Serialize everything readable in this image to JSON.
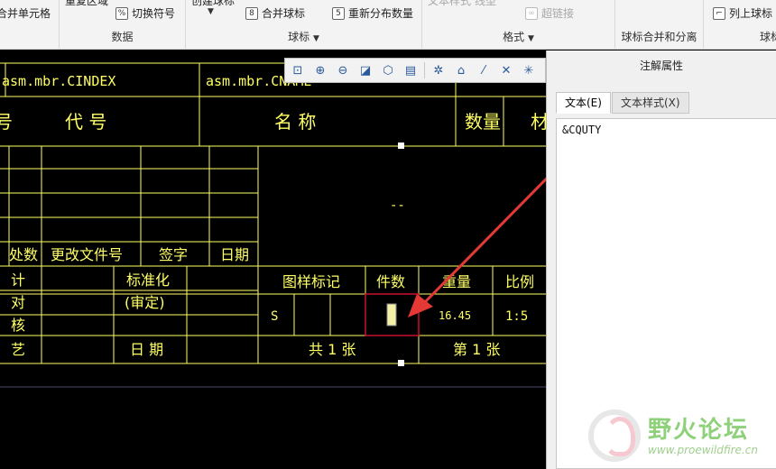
{
  "ribbon": {
    "row1": {
      "repeat_region": "重复区域",
      "create_balloon": "创建球标",
      "text_style": "文本样式",
      "line_style": "线型",
      "hyperlink": "超链接"
    },
    "merge_cells": "合并单元格",
    "toggle_symbol": "切换符号",
    "merge_balloons": "合并球标",
    "redistribute_qty": "重新分布数量",
    "list_balloons": "列上球标",
    "groups": {
      "data": "数据",
      "balloon": "球标",
      "format": "格式",
      "balloon_merge_split": "球标合并和分离",
      "balloon_cut": "球标"
    }
  },
  "view_toolbar": {
    "icons": [
      "zoom-fit-icon",
      "zoom-in-icon",
      "zoom-out-icon",
      "repaint-icon",
      "view-orient-icon",
      "sheet-icon",
      "datum-display-icon",
      "annotation-display-icon",
      "axis-display-icon",
      "point-display-icon",
      "csys-display-icon"
    ]
  },
  "title_block": {
    "asm_index": "asm.mbr.CINDEX",
    "asm_name": "asm.mbr.CNAME",
    "row_header": {
      "seq": "号",
      "code": "代  号",
      "name": "名   称",
      "qty": "数量",
      "material": "材"
    },
    "dash": "--",
    "revision": {
      "count": "处数",
      "doc_no": "更改文件号",
      "sign": "签字",
      "date": "日期"
    },
    "left_labels": [
      "计",
      "对",
      "核",
      "艺"
    ],
    "standardize": "标准化",
    "review": "(审定)",
    "date2": "日  期",
    "drawing_mark": "图样标记",
    "piece_count": "件数",
    "weight": "重量",
    "scale": "比例",
    "stage": "S",
    "weight_value": "16.45",
    "scale_value": "1:5",
    "total_sheets": "共 1 张",
    "sheet_no": "第 1 张"
  },
  "panel": {
    "title": "注解属性",
    "tabs": [
      {
        "label": "文本(E)"
      },
      {
        "label": "文本样式(X)"
      }
    ],
    "text_value": "&CQUTY"
  },
  "watermark": {
    "title": "野火论坛",
    "url": "www.proewildfire.cn"
  },
  "colors": {
    "drawing_line": "#ffff66",
    "highlight": "#c8102e",
    "arrow": "#e53935"
  }
}
